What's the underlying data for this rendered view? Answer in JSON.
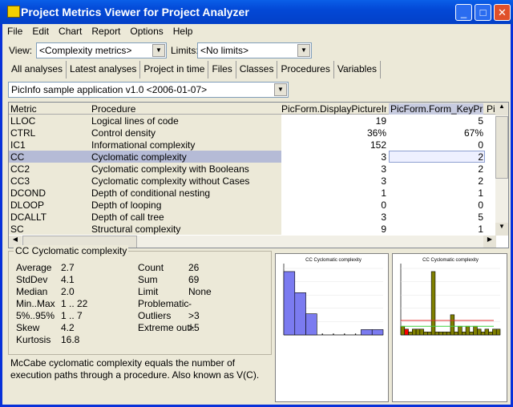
{
  "window": {
    "title": "Project Metrics Viewer for Project Analyzer"
  },
  "menu": [
    "File",
    "Edit",
    "Chart",
    "Report",
    "Options",
    "Help"
  ],
  "view": {
    "label": "View:",
    "value": "<Complexity metrics>"
  },
  "limits": {
    "label": "Limits:",
    "value": "<No limits>"
  },
  "tabs": [
    "All analyses",
    "Latest analyses",
    "Project in time",
    "Files",
    "Classes",
    "Procedures",
    "Variables"
  ],
  "active_tab": "Procedures",
  "project": "PicInfo sample application v1.0  <2006-01-07>",
  "table": {
    "headers": [
      "Metric",
      "Procedure",
      "PicForm.DisplayPictureInfo",
      "PicForm.Form_KeyPress",
      "Pi"
    ],
    "rows": [
      [
        "LLOC",
        "Logical lines of code",
        "19",
        "5"
      ],
      [
        "CTRL",
        "Control density",
        "36%",
        "67%"
      ],
      [
        "IC1",
        "Informational complexity",
        "152",
        "0"
      ],
      [
        "CC",
        "Cyclomatic complexity",
        "3",
        "2"
      ],
      [
        "CC2",
        "Cyclomatic complexity with Booleans",
        "3",
        "2"
      ],
      [
        "CC3",
        "Cyclomatic complexity without Cases",
        "3",
        "2"
      ],
      [
        "DCOND",
        "Depth of conditional nesting",
        "1",
        "1"
      ],
      [
        "DLOOP",
        "Depth of looping",
        "0",
        "0"
      ],
      [
        "DCALLT",
        "Depth of call tree",
        "3",
        "5"
      ],
      [
        "SC",
        "Structural complexity",
        "9",
        "1"
      ]
    ],
    "selected_row": 3
  },
  "stats": {
    "title": "CC Cyclomatic complexity",
    "left": [
      [
        "Average",
        "2.7"
      ],
      [
        "StdDev",
        "4.1"
      ],
      [
        "Median",
        "2.0"
      ],
      [
        "Min..Max",
        "1 .. 22"
      ],
      [
        "5%..95%",
        "1 .. 7"
      ],
      [
        "Skew",
        "4.2"
      ],
      [
        "Kurtosis",
        "16.8"
      ]
    ],
    "right": [
      [
        "Count",
        "26"
      ],
      [
        "Sum",
        "69"
      ],
      [
        "Limit",
        "None"
      ],
      [
        "Problematic",
        "-"
      ],
      [
        "Outliers",
        ">3"
      ],
      [
        "Extreme outl.",
        ">5"
      ]
    ]
  },
  "description": "McCabe cyclomatic complexity equals the number of execution paths through a procedure. Also known as V(C).",
  "colors": {
    "hist": "#7b7bf0",
    "bars": "#808000",
    "highlight": "#ff0000",
    "outlier_line": "#e03030",
    "median_line": "#40d040"
  },
  "chart_data": [
    {
      "type": "bar",
      "title": "CC Cyclomatic complexity",
      "values": [
        12,
        8,
        4,
        0,
        0,
        0,
        0,
        1,
        1
      ]
    },
    {
      "type": "bar",
      "title": "CC Cyclomatic complexity",
      "values": [
        3,
        2,
        1,
        2,
        2,
        2,
        1,
        1,
        22,
        1,
        1,
        1,
        1,
        7,
        1,
        3,
        1,
        3,
        1,
        3,
        2,
        1,
        2,
        1,
        2,
        2
      ],
      "highlighted_index": 1,
      "reference_lines": [
        3,
        5
      ]
    }
  ]
}
